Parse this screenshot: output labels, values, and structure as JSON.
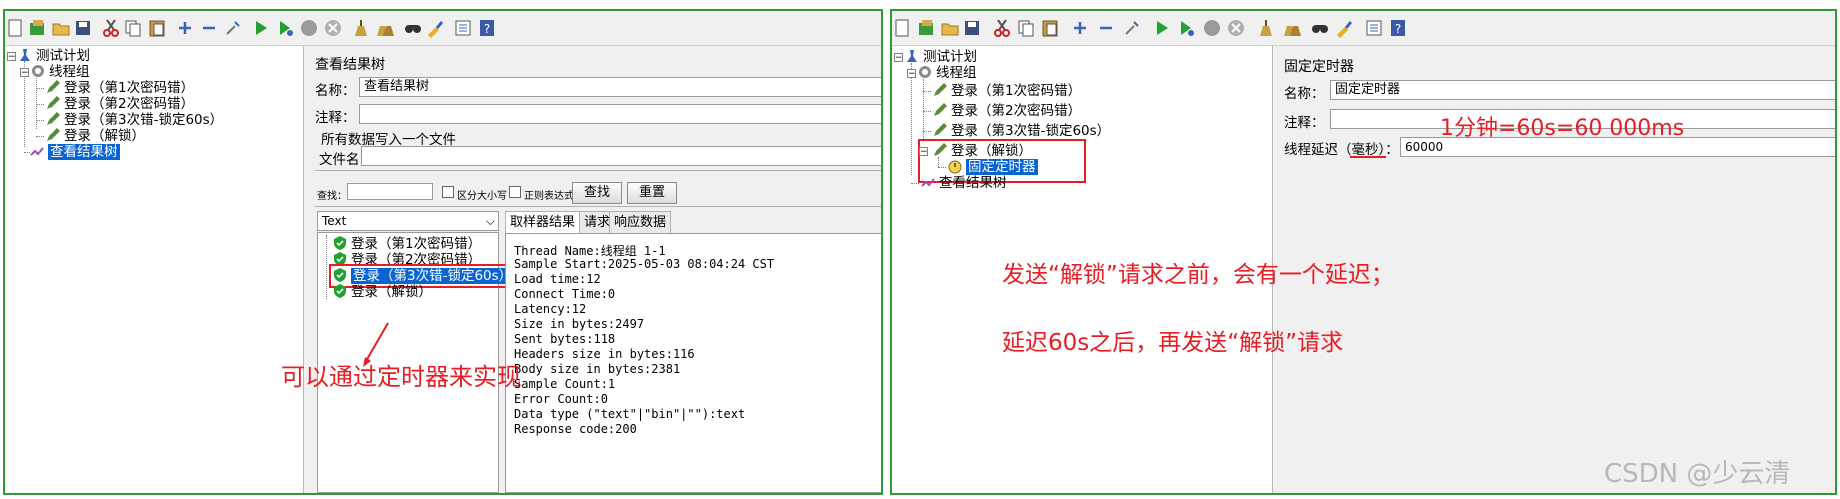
{
  "colors": {
    "panel_border": "#2e9a3c",
    "selection": "#0a64d2",
    "annotation": "#e81c24"
  },
  "toolbar_icons": [
    "new-icon",
    "templates-icon",
    "open-icon",
    "save-icon",
    "cut-icon",
    "copy-icon",
    "paste-icon",
    "expand-icon",
    "collapse-icon",
    "toggle-icon",
    "start-icon",
    "start-no-pause-icon",
    "stop-icon",
    "shutdown-icon",
    "clear-icon",
    "clear-all-icon",
    "search-icon",
    "reset-search-icon",
    "function-helper-icon",
    "help-icon"
  ],
  "left": {
    "tree": {
      "plan": "测试计划",
      "group": "线程组",
      "samplers": [
        "登录（第1次密码错）",
        "登录（第2次密码错）",
        "登录（第3次错-锁定60s）",
        "登录（解锁）"
      ],
      "listener": "查看结果树"
    },
    "panel": {
      "title": "查看结果树",
      "name_label": "名称：",
      "name_value": "查看结果树",
      "comment_label": "注释：",
      "file_section": "所有数据写入一个文件",
      "filename_label": "文件名",
      "search_label": "查找：",
      "case_label": "区分大小写",
      "regex_label": "正则表达式",
      "find_button": "查找",
      "reset_button": "重置",
      "renderer": "Text",
      "results": [
        "登录（第1次密码错）",
        "登录（第2次密码错）",
        "登录（第3次错-锁定60s）",
        "登录（解锁）"
      ],
      "tabs": [
        "取样器结果",
        "请求",
        "响应数据"
      ],
      "sampler_result": [
        "Thread Name:线程组 1-1",
        "Sample Start:2025-05-03 08:04:24 CST",
        "Load time:12",
        "Connect Time:0",
        "Latency:12",
        "Size in bytes:2497",
        "Sent bytes:118",
        "Headers size in bytes:116",
        "Body size in bytes:2381",
        "Sample Count:1",
        "Error Count:0",
        "Data type (\"text\"|\"bin\"|\"\"):text",
        "Response code:200"
      ]
    },
    "annotation": "可以通过定时器来实现"
  },
  "right": {
    "tree": {
      "plan": "测试计划",
      "group": "线程组",
      "samplers": [
        "登录（第1次密码错）",
        "登录（第2次密码错）",
        "登录（第3次错-锁定60s）",
        "登录（解锁）"
      ],
      "timer": "固定定时器",
      "listener": "查看结果树"
    },
    "panel": {
      "title": "固定定时器",
      "name_label": "名称：",
      "name_value": "固定定时器",
      "comment_label": "注释：",
      "delay_label": "线程延迟（毫秒）：",
      "delay_value": "60000"
    },
    "annotations": {
      "conversion": "1分钟=60s=60 000ms",
      "line1": "发送“解锁”请求之前，会有一个延迟；",
      "line2": "延迟60s之后，再发送“解锁”请求"
    }
  },
  "watermark": "CSDN @少云清"
}
